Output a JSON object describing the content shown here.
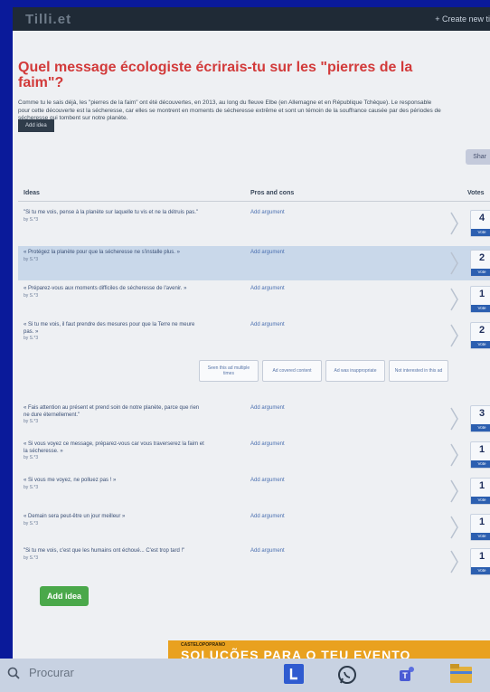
{
  "header": {
    "logo": "Tilli.et",
    "create_link": "+ Create new ti"
  },
  "page": {
    "title": "Quel message écologiste écrirais-tu sur les \"pierres de la faim\"?",
    "intro": "Comme tu le sais déjà, les \"pierres de la faim\" ont été découvertes, en 2013, au long du fleuve Elbe (en Allemagne et en République Tchèque). Le responsable pour cette découverte est la sécheresse, car elles se montrent en moments de sécheresse extrême et sont un témoin de la souffrance causée par des périodes de sécheresse qui tombent sur notre planète.",
    "add_idea_top": "Add idea",
    "share": "Shar",
    "add_idea_bottom": "Add idea"
  },
  "table": {
    "col_ideas": "Ideas",
    "col_pros": "Pros and cons",
    "col_votes": "Votes",
    "arg_label": "Add argument",
    "vote_label": "Vote",
    "rows_top": [
      {
        "text": "\"Si tu me vois, pense à la planète sur laquelle tu vis et ne la détruis pas.\"",
        "by": "by S.*3",
        "votes": "4"
      },
      {
        "text": "« Protégez la planète pour que la sécheresse ne s'installe plus. »",
        "by": "by S.*3",
        "votes": "2"
      },
      {
        "text": "« Préparez-vous aux moments difficiles de sécheresse de l'avenir. »",
        "by": "by S.*3",
        "votes": "1"
      },
      {
        "text": "« Si tu me vois, il faut prendre des mesures pour que la Terre ne meure pas. »",
        "by": "by S.*3",
        "votes": "2"
      }
    ],
    "rows_bottom": [
      {
        "text": "« Fais attention au présent et prend soin de notre planète, parce que rien ne dure éternellement.\"",
        "by": "by S.*3",
        "votes": "3"
      },
      {
        "text": "« Si vous voyez ce message, préparez-vous car vous traverserez la faim et la sécheresse. »",
        "by": "by S.*3",
        "votes": "1"
      },
      {
        "text": "« Si vous me voyez, ne polluez pas ! »",
        "by": "by S.*3",
        "votes": "1"
      },
      {
        "text": "« Demain sera peut-être un jour meilleur »",
        "by": "by S.*3",
        "votes": "1"
      },
      {
        "text": "\"Si tu me vois, c'est que les humains ont échoué... C'est trop tard !\"",
        "by": "by S.*3",
        "votes": "1"
      }
    ]
  },
  "feedback": {
    "seen": "Seen this ad multiple times",
    "covered": "Ad covered content",
    "inappropriate": "Ad was inappropriate",
    "not_interested": "Not interested in this ad"
  },
  "ad": {
    "brand": "CASTELOPOPRANO",
    "text": "SOLUÇÕES PARA O TEU EVENTO"
  },
  "taskbar": {
    "search_placeholder": "Procurar"
  },
  "colors": {
    "title": "#d23a3a",
    "vote_button": "#2c5fb0",
    "add_idea_green": "#4aa84a",
    "taskbar_bg": "#c8d2e2"
  }
}
